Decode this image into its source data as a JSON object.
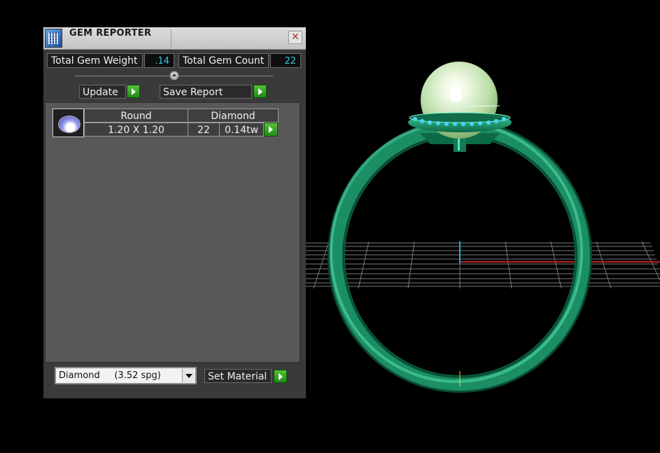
{
  "panel": {
    "title": "GEM REPORTER",
    "close_glyph": "✕",
    "total_weight_label": "Total Gem Weight",
    "total_weight_value": ".14",
    "total_count_label": "Total Gem Count",
    "total_count_value": "22",
    "update_label": "Update",
    "save_report_label": "Save Report",
    "gems": [
      {
        "shape": "Round",
        "material": "Diamond",
        "size": "1.20 X 1.20",
        "count": "22",
        "weight": "0.14tw",
        "thumbnail_icon": "round-gem-icon"
      }
    ],
    "material_select": {
      "value": "Diamond     (3.52 spg)"
    },
    "set_material_label": "Set Material"
  },
  "icons": {
    "app": "gem-reporter-icon",
    "close": "close-icon",
    "go": "play-arrow-icon",
    "dropdown": "chevron-down-icon"
  },
  "colors": {
    "value_text": "#39c6e6",
    "go_button": "#2fa624",
    "ring_metal": "#1a8a60",
    "pearl": "#d8f0c8",
    "axis_x": "#c02020",
    "axis_y": "#20b0c8"
  }
}
